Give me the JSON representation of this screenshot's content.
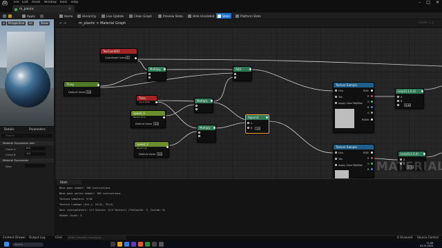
{
  "titlebar": {
    "logo": "U",
    "menus": [
      "File",
      "Edit",
      "Asset",
      "Window",
      "Tools",
      "Help"
    ],
    "controls": [
      "–",
      "□",
      "✕"
    ]
  },
  "tab": {
    "label": "m_plastic",
    "close": "×"
  },
  "toolbar": {
    "buttons": [
      "Apply",
      "Home",
      "Hierarchy",
      "Live Update",
      "Clean Graph",
      "Preview State",
      "Hide Unrelated",
      "Stats",
      "Platform Stats"
    ],
    "active": "Stats"
  },
  "viewport": {
    "buttons": [
      "Perspective",
      "Lit",
      "Show"
    ]
  },
  "details": {
    "tabs": [
      "Details",
      "Parameters"
    ],
    "search_placeholder": "Search",
    "sections": [
      "Material Expression Add",
      "Material Expression",
      "Desc"
    ],
    "props": [
      {
        "label": "Const A",
        "value": "0.0"
      },
      {
        "label": "Const B",
        "value": "1.0"
      }
    ]
  },
  "graph": {
    "nav": "← →",
    "breadcrumb": "m_plastic  >  Material Graph",
    "zoom": "Zoom 1:1",
    "watermark": "MATERIAL",
    "nodes": {
      "texcoord": {
        "title": "TexCoord[0]",
        "row": "Coordinate Index",
        "value": "0"
      },
      "tiling": {
        "title": "Tiling",
        "row": "Default Value",
        "value": "1.0"
      },
      "time": {
        "title": "Time",
        "sub": "Input Data"
      },
      "speed_u": {
        "title": "speed_U",
        "sub": "Param (0.1)",
        "row": "Default Value",
        "value": "0.0"
      },
      "speed_v": {
        "title": "speed_V",
        "sub": "Param (0)",
        "row": "Default Value",
        "value": "0.0"
      },
      "mult1": {
        "title": "Multiply"
      },
      "mult2": {
        "title": "Multiply"
      },
      "mult3": {
        "title": "Multiply"
      },
      "add": {
        "title": "Add"
      },
      "append": {
        "title": "Append",
        "a": "A",
        "b": "B",
        "value": "1.0"
      },
      "tex1": {
        "title": "Texture Sample",
        "uvs": "UVs",
        "tex": "Tex",
        "apply": "Apply View MipBias",
        "out": [
          "RGB",
          "R",
          "G",
          "B",
          "A",
          "RGBA"
        ]
      },
      "tex2": {
        "title": "Texture Sample",
        "uvs": "UVs",
        "tex": "Tex",
        "apply": "Apply View MipBias",
        "out": [
          "RGB",
          "R",
          "G",
          "B"
        ]
      },
      "lerp1": {
        "title": "Lerp(0,1,0.4)",
        "a": "A",
        "b": "B",
        "alpha": "Alpha",
        "value": "0.40"
      },
      "lerp2": {
        "title": "Lerp(0,1,0.4)",
        "a": "A",
        "b": "B",
        "value": "0.40"
      }
    }
  },
  "stats": {
    "tab": "Stats",
    "lines": [
      "Base pass shader: 236 instructions",
      "Base pass vertex shader: 169 instructions",
      "Texture samplers: 5/16",
      "Texture Lookups (Est.): VS(3), PS(5)",
      "User interpolators: 2/4 Scalars (1/4 Vectors) (TexCoords: 2, Custom: 0)",
      "Shader Count: 3"
    ]
  },
  "statusbar": {
    "items": [
      "Content Drawer",
      "Output Log",
      "Cmd"
    ],
    "cmd_placeholder": "Enter Console Command",
    "right": [
      "4 Unsaved",
      "Source Control"
    ]
  },
  "taskbar": {
    "search": "Search",
    "time": "11:08",
    "date": "03.05.2023"
  },
  "colors": {
    "accent": "#1c6fc9",
    "function_header": "#2f7a57",
    "param_header": "#6a8f2c",
    "texcoord_header": "#a32424",
    "texture_header": "#1f5f8a",
    "selected": "#ff9f2a"
  }
}
